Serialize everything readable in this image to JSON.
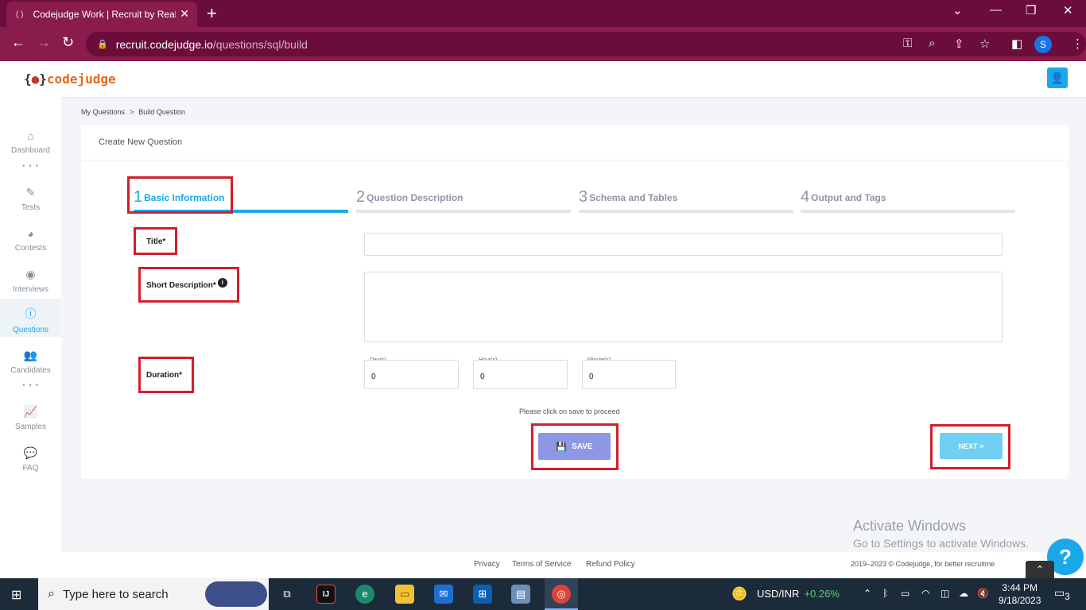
{
  "browser": {
    "tab_title": "Codejudge Work | Recruit by Real",
    "url_domain": "recruit.codejudge.io",
    "url_path": "/questions/sql/build",
    "profile_initial": "S"
  },
  "app": {
    "logo_brace_open": "{",
    "logo_dot": "●",
    "logo_brace_close": "}",
    "logo_text": "codejudge"
  },
  "sidebar": {
    "items": [
      {
        "label": "Dashboard",
        "icon": "home-icon"
      },
      {
        "label": "Tests",
        "icon": "pencil-icon"
      },
      {
        "label": "Contests",
        "icon": "pie-chart-icon"
      },
      {
        "label": "Interviews",
        "icon": "podcast-icon"
      },
      {
        "label": "Questions",
        "icon": "question-circle-icon"
      },
      {
        "label": "Candidates",
        "icon": "users-icon"
      },
      {
        "label": "Samples",
        "icon": "line-chart-icon"
      },
      {
        "label": "FAQ",
        "icon": "comments-icon"
      }
    ],
    "active": "Questions"
  },
  "breadcrumb": {
    "items": [
      "My Questions",
      "Build Question"
    ],
    "separator": ">"
  },
  "card": {
    "header": "Create New Question"
  },
  "steps": [
    {
      "num": "1",
      "label": "Basic Information",
      "active": true
    },
    {
      "num": "2",
      "label": "Question Description",
      "active": false
    },
    {
      "num": "3",
      "label": "Schema and Tables",
      "active": false
    },
    {
      "num": "4",
      "label": "Output and Tags",
      "active": false
    }
  ],
  "form": {
    "title_label": "Title*",
    "title_value": "",
    "short_desc_label": "Short Description*",
    "short_desc_value": "",
    "duration_label": "Duration*",
    "days_label": "Day(s)",
    "days_value": "0",
    "hours_label": "Hour(s)",
    "hours_value": "0",
    "minutes_label": "Minute(s)",
    "minutes_value": "0",
    "hint": "Please click on save to proceed",
    "save_label": "SAVE",
    "next_label": "NEXT >"
  },
  "footer": {
    "privacy": "Privacy",
    "terms": "Terms of Service",
    "refund": "Refund Policy",
    "copyright": "2019–2023 ©  Codejudge, for better recruitme"
  },
  "watermark": {
    "line1": "Activate Windows",
    "line2": "Go to Settings to activate Windows."
  },
  "taskbar": {
    "search_placeholder": "Type here to search",
    "ticker_label": "USD/INR",
    "ticker_change": "+0.26%",
    "time": "3:44 PM",
    "date": "9/18/2023",
    "notifications": "3"
  },
  "colors": {
    "accent": "#1aa9e8",
    "chrome": "#8a1c4d",
    "highlight": "#d21f2b",
    "save": "#8e97e6"
  }
}
